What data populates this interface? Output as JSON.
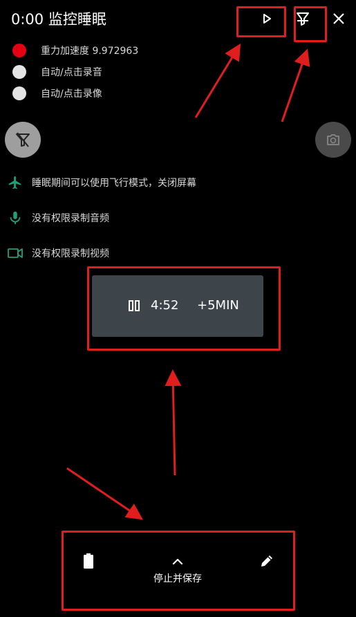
{
  "header": {
    "title": "0:00 监控睡眠",
    "play_icon": "play-icon",
    "filter_icon": "filter-icon",
    "close_icon": "close-icon"
  },
  "status": [
    {
      "label": "重力加速度 9.972963",
      "color": "#e60012"
    },
    {
      "label": "自动/点击录音",
      "color": "#e4e4e4"
    },
    {
      "label": "自动/点击录像",
      "color": "#e4e4e4"
    }
  ],
  "controls": {
    "left_icon": "funnel-off-icon",
    "right_icon": "camera-flip-icon"
  },
  "info": [
    {
      "label": "睡眠期间可以使用飞行模式，关闭屏幕",
      "icon": "airplane-icon",
      "color": "#1fa07a"
    },
    {
      "label": "没有权限录制音频",
      "icon": "microphone-icon",
      "color": "#1fa07a"
    },
    {
      "label": "没有权限录制视频",
      "icon": "video-camera-icon",
      "color": "#1fa07a"
    }
  ],
  "timer": {
    "time": "4:52",
    "extend_label": "+5MIN",
    "pause_icon": "pause-icon"
  },
  "bottom": {
    "stop_label": "停止并保存",
    "battery_icon": "battery-icon",
    "chevron_icon": "chevron-up-icon",
    "edit_icon": "pencil-icon"
  },
  "annotation_color": "#e01e1e"
}
